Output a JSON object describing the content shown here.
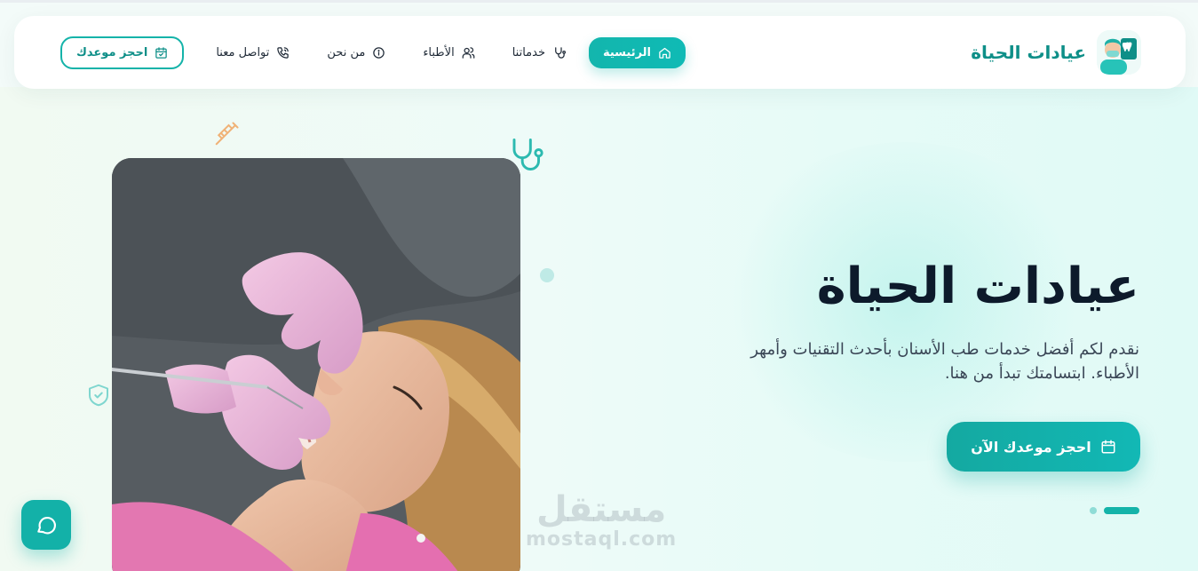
{
  "brand": {
    "name": "عيادات الحياة",
    "logo_icon": "dentist-avatar-icon"
  },
  "nav": {
    "items": [
      {
        "label": "الرئيسية",
        "icon": "home-icon",
        "active": true
      },
      {
        "label": "خدماتنا",
        "icon": "stethoscope-icon",
        "active": false
      },
      {
        "label": "الأطباء",
        "icon": "users-icon",
        "active": false
      },
      {
        "label": "من نحن",
        "icon": "info-icon",
        "active": false
      },
      {
        "label": "تواصل معنا",
        "icon": "phone-icon",
        "active": false
      }
    ],
    "book_label": "احجز موعدك"
  },
  "hero": {
    "title": "عيادات الحياة",
    "subtitle": "نقدم لكم أفضل خدمات طب الأسنان بأحدث التقنيات وأمهر الأطباء. ابتسامتك تبدأ من هنا.",
    "cta_label": "احجز موعدك الآن",
    "slider": {
      "current": 1,
      "total": 2
    }
  },
  "watermark": {
    "ar": "مستقل",
    "en": "mostaql.com"
  },
  "colors": {
    "accent": "#14b3a9",
    "dark": "#0d1a2b",
    "glove": "#e8b6d6"
  }
}
